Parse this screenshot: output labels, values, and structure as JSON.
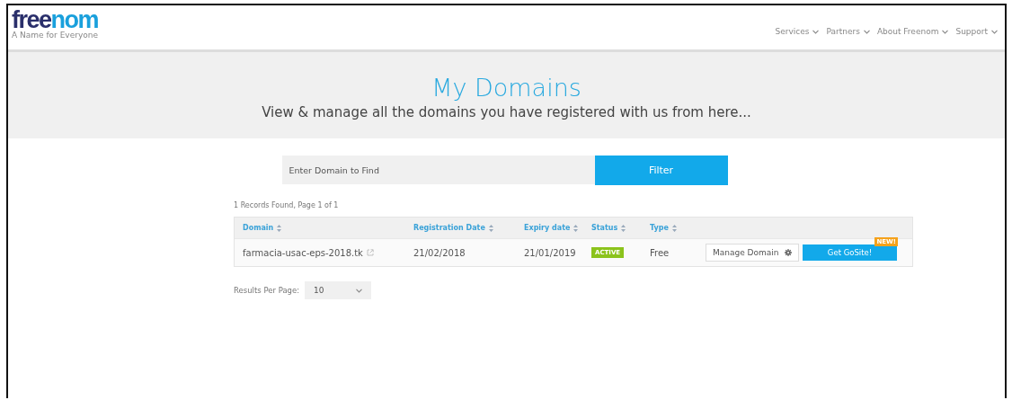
{
  "header": {
    "logo": {
      "part_1": "free",
      "part_2": "nom"
    },
    "tagline": "A Name for Everyone",
    "nav": [
      {
        "label": "Services"
      },
      {
        "label": "Partners"
      },
      {
        "label": "About Freenom"
      },
      {
        "label": "Support"
      }
    ]
  },
  "banner": {
    "title": "My Domains",
    "subtitle": "View & manage all the domains you have registered with us from here..."
  },
  "search": {
    "placeholder": "Enter Domain to Find",
    "button": "Filter"
  },
  "records_info": "1 Records Found, Page 1 of 1",
  "table": {
    "columns": [
      "Domain",
      "Registration Date",
      "Expiry date",
      "Status",
      "Type"
    ],
    "rows": [
      {
        "domain": "farmacia-usac-eps-2018.tk",
        "registration_date": "21/02/2018",
        "expiry_date": "21/01/2019",
        "status": "ACTIVE",
        "type": "Free",
        "manage_button": "Manage Domain",
        "gosite_button": "Get GoSite!",
        "badge": "NEW!"
      }
    ]
  },
  "results_per_page": {
    "label": "Results Per Page:",
    "value": "10"
  }
}
